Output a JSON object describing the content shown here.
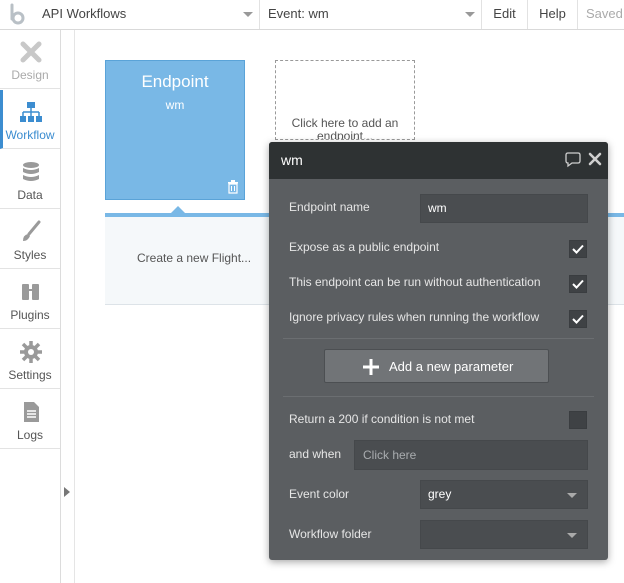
{
  "topbar": {
    "page_select": "API Workflows",
    "event_select": "Event: wm",
    "edit": "Edit",
    "help": "Help",
    "saved": "Saved"
  },
  "sidebar": {
    "items": [
      {
        "label": "Design",
        "icon": "design-icon"
      },
      {
        "label": "Workflow",
        "icon": "workflow-icon"
      },
      {
        "label": "Data",
        "icon": "data-icon"
      },
      {
        "label": "Styles",
        "icon": "styles-icon"
      },
      {
        "label": "Plugins",
        "icon": "plugins-icon"
      },
      {
        "label": "Settings",
        "icon": "gear-icon"
      },
      {
        "label": "Logs",
        "icon": "logs-icon"
      }
    ],
    "active": "Workflow"
  },
  "canvas": {
    "endpoint_title": "Endpoint",
    "endpoint_name": "wm",
    "add_endpoint": "Click here to add an endpoint...",
    "create_action": "Create a new Flight..."
  },
  "panel": {
    "title": "wm",
    "endpoint_name_label": "Endpoint name",
    "endpoint_name_value": "wm",
    "expose_label": "Expose as a public endpoint",
    "expose_checked": true,
    "no_auth_label": "This endpoint can be run without authentication",
    "no_auth_checked": true,
    "ignore_privacy_label": "Ignore privacy rules when running the workflow",
    "ignore_privacy_checked": true,
    "add_param_button": "Add a new parameter",
    "return200_label": "Return a 200 if condition is not met",
    "return200_checked": false,
    "and_when_label": "and when",
    "and_when_placeholder": "Click here",
    "event_color_label": "Event color",
    "event_color_value": "grey",
    "folder_label": "Workflow folder",
    "folder_value": ""
  },
  "colors": {
    "accent": "#3c8dd0",
    "endpoint_card": "#79b8e6",
    "panel_bg": "#5b5e61",
    "panel_header": "#2e3233"
  }
}
